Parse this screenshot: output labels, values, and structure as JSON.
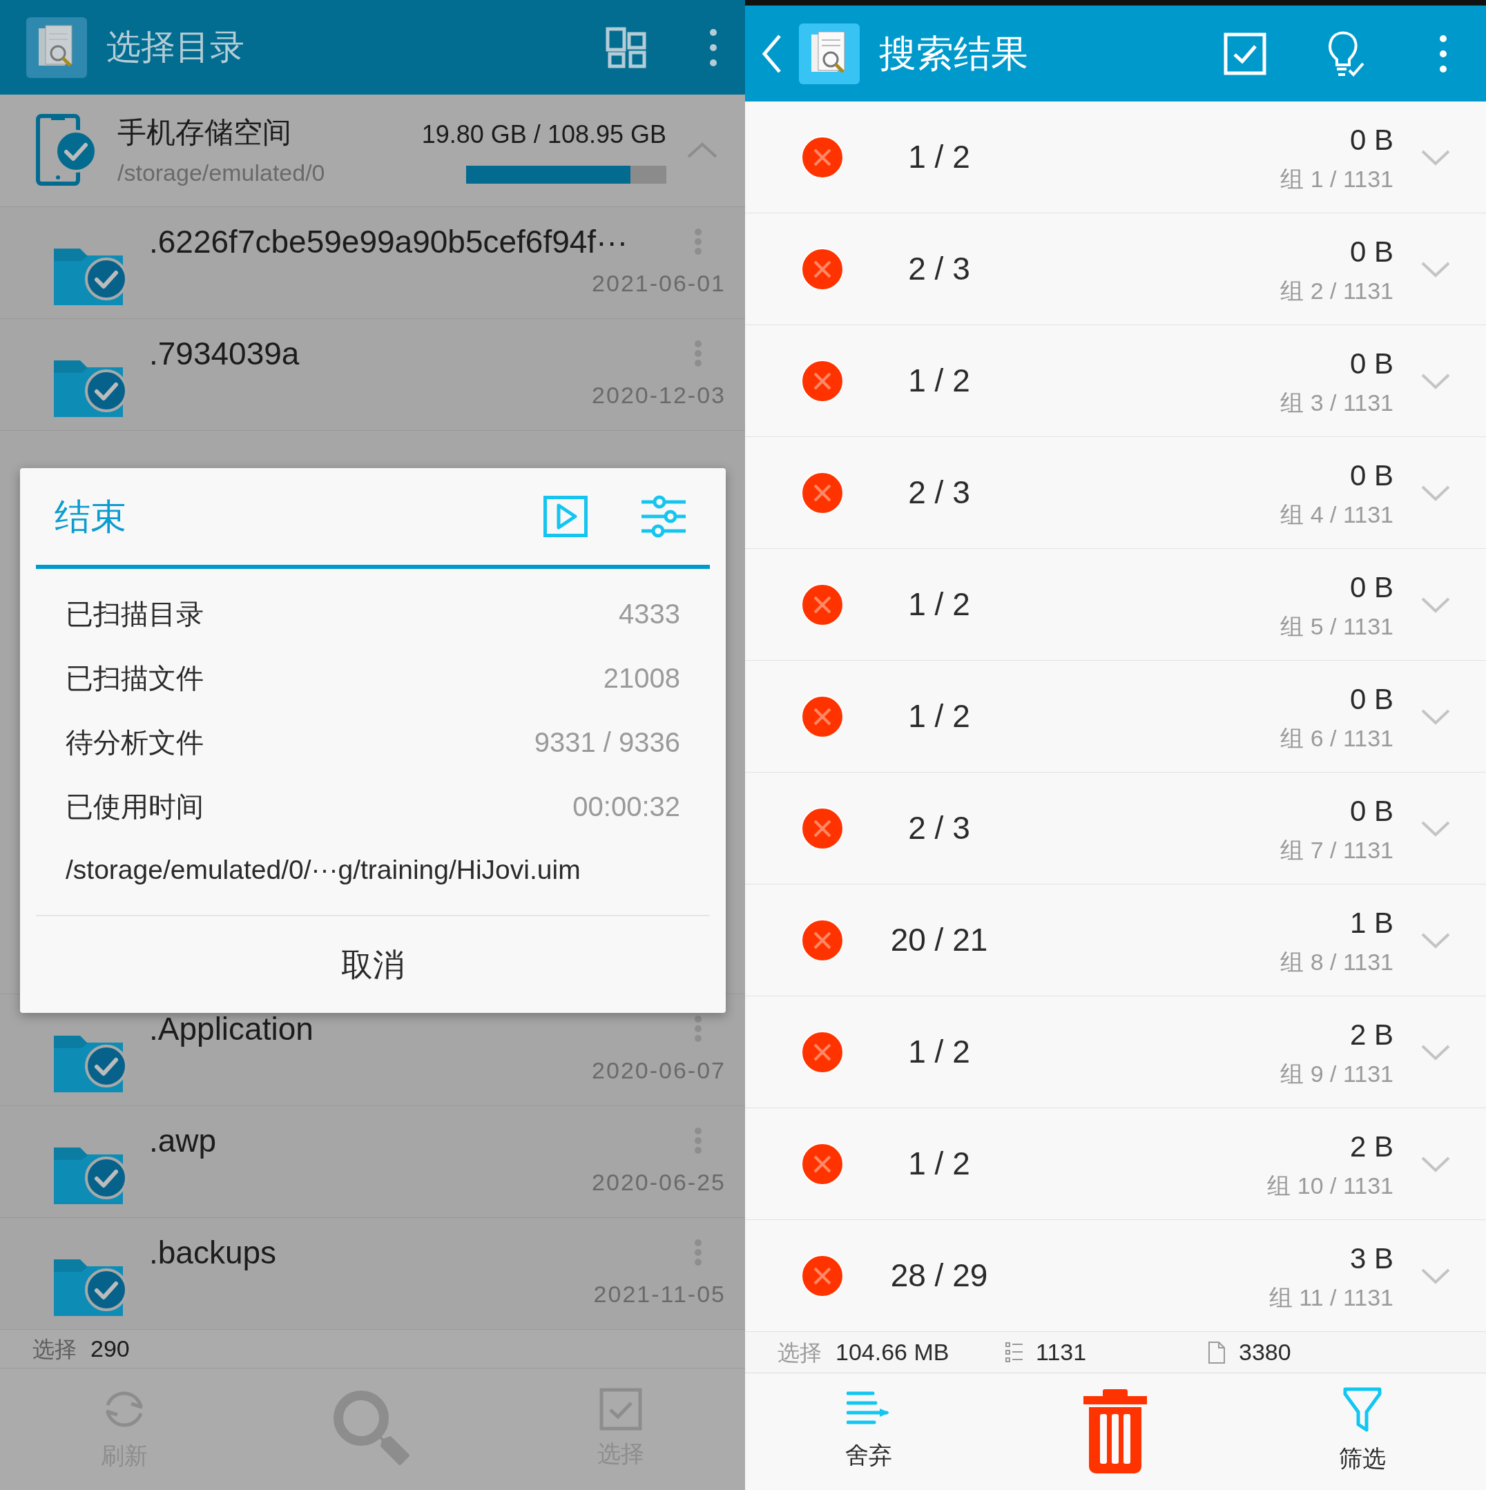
{
  "left_panel": {
    "header": {
      "title": "选择目录"
    },
    "storage": {
      "name": "手机存储空间",
      "usage": "19.80 GB / 108.95 GB",
      "path": "/storage/emulated/0",
      "level": 0.82,
      "expanded": true,
      "checked": true
    },
    "folders_above": [
      {
        "name": ".6226f7cbe59e99a90b5cef6f94f···",
        "date": "2021-06-01",
        "checked": true
      },
      {
        "name": ".7934039a",
        "date": "2020-12-03",
        "checked": true
      }
    ],
    "folders_below": [
      {
        "name": ".Application",
        "date": "2020-06-07",
        "checked": true
      },
      {
        "name": ".awp",
        "date": "2020-06-25",
        "checked": true
      },
      {
        "name": ".backups",
        "date": "2021-11-05",
        "checked": true
      }
    ],
    "status_bar": {
      "label": "选择",
      "count": "290"
    },
    "bottom_nav": [
      {
        "kind": "refresh",
        "label": "刷新"
      },
      {
        "kind": "search"
      },
      {
        "kind": "select",
        "label": "选择"
      }
    ]
  },
  "dialog": {
    "title": "结束",
    "stats": [
      {
        "label": "已扫描目录",
        "value": "4333"
      },
      {
        "label": "已扫描文件",
        "value": "21008"
      },
      {
        "label": "待分析文件",
        "value": "9331 / 9336"
      },
      {
        "label": "已使用时间",
        "value": "00:00:32"
      }
    ],
    "current_path": "/storage/emulated/0/···g/training/HiJovi.uim",
    "cancel": "取消"
  },
  "right_panel": {
    "header": {
      "title": "搜索结果"
    },
    "groups": [
      {
        "count": "1 / 2",
        "size": "0 B",
        "group": "组 1 / 1131",
        "expanded": false
      },
      {
        "count": "2 / 3",
        "size": "0 B",
        "group": "组 2 / 1131",
        "expanded": false
      },
      {
        "count": "1 / 2",
        "size": "0 B",
        "group": "组 3 / 1131",
        "expanded": false
      },
      {
        "count": "2 / 3",
        "size": "0 B",
        "group": "组 4 / 1131",
        "expanded": false
      },
      {
        "count": "1 / 2",
        "size": "0 B",
        "group": "组 5 / 1131",
        "expanded": false
      },
      {
        "count": "1 / 2",
        "size": "0 B",
        "group": "组 6 / 1131",
        "expanded": false
      },
      {
        "count": "2 / 3",
        "size": "0 B",
        "group": "组 7 / 1131",
        "expanded": false
      },
      {
        "count": "20 / 21",
        "size": "1 B",
        "group": "组 8 / 1131",
        "expanded": false
      },
      {
        "count": "1 / 2",
        "size": "2 B",
        "group": "组 9 / 1131",
        "expanded": false
      },
      {
        "count": "1 / 2",
        "size": "2 B",
        "group": "组 10 / 1131",
        "expanded": false
      },
      {
        "count": "28 / 29",
        "size": "3 B",
        "group": "组 11 / 1131",
        "expanded": false
      }
    ],
    "status_bar": {
      "label": "选择",
      "size": "104.66 MB",
      "groups": "1131",
      "files": "3380"
    },
    "bottom_nav": [
      {
        "kind": "discard",
        "label": "舍弃"
      },
      {
        "kind": "delete"
      },
      {
        "kind": "filter",
        "label": "筛选"
      }
    ]
  }
}
